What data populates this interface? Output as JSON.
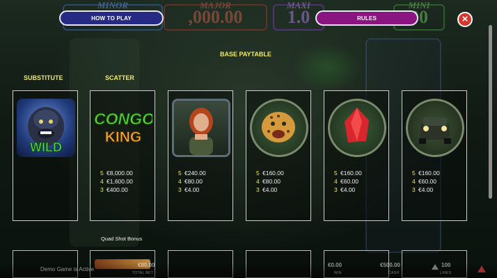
{
  "header": {
    "how_to_play_label": "HOW TO PLAY",
    "rules_label": "RULES",
    "close_label": "×"
  },
  "jackpots": [
    {
      "name": "MINOR",
      "value": ""
    },
    {
      "name": "MAJOR",
      "value": ",000.00"
    },
    {
      "name": "MAXI",
      "value": "1.0"
    },
    {
      "name": "MINI",
      "value": "00"
    }
  ],
  "paytable": {
    "title": "BASE PAYTABLE",
    "substitute_label": "SUBSTITUTE",
    "scatter_label": "SCATTER",
    "wild_text": "WILD",
    "logo_line1": "CONGO",
    "logo_line2": "KING",
    "symbols": [
      {
        "name": "gorilla-wild",
        "pays": []
      },
      {
        "name": "congo-king-logo",
        "pays": [
          {
            "n": "5",
            "v": "€8,000.00"
          },
          {
            "n": "4",
            "v": "€1,600.00"
          },
          {
            "n": "3",
            "v": "€400.00"
          }
        ]
      },
      {
        "name": "woman",
        "pays": [
          {
            "n": "5",
            "v": "€240.00"
          },
          {
            "n": "4",
            "v": "€80.00"
          },
          {
            "n": "3",
            "v": "€4.00"
          }
        ]
      },
      {
        "name": "leopard",
        "pays": [
          {
            "n": "5",
            "v": "€160.00"
          },
          {
            "n": "4",
            "v": "€80.00"
          },
          {
            "n": "3",
            "v": "€4.00"
          }
        ]
      },
      {
        "name": "red-gem",
        "pays": [
          {
            "n": "5",
            "v": "€160.00"
          },
          {
            "n": "4",
            "v": "€60.00"
          },
          {
            "n": "3",
            "v": "€4.00"
          }
        ]
      },
      {
        "name": "jeep",
        "pays": [
          {
            "n": "5",
            "v": "€160.00"
          },
          {
            "n": "4",
            "v": "€60.00"
          },
          {
            "n": "3",
            "v": "€4.00"
          }
        ]
      }
    ],
    "quad_shot_label": "Quad Shot Bonus"
  },
  "footer": {
    "demo_text": "Demo Game is Active",
    "total_bet_value": "€80.00",
    "total_bet_label": "TOTAL BET",
    "win_value": "€0.00",
    "win_label": "WIN",
    "cash_value": "€500.00",
    "cash_label": "CASH",
    "lines_value": "100",
    "lines_label": "LINES"
  },
  "colors": {
    "header_yellow": "#f2ea57",
    "how_to_play_bg": "#272a83",
    "rules_bg": "#8b1580",
    "close_bg": "#d5372e"
  }
}
